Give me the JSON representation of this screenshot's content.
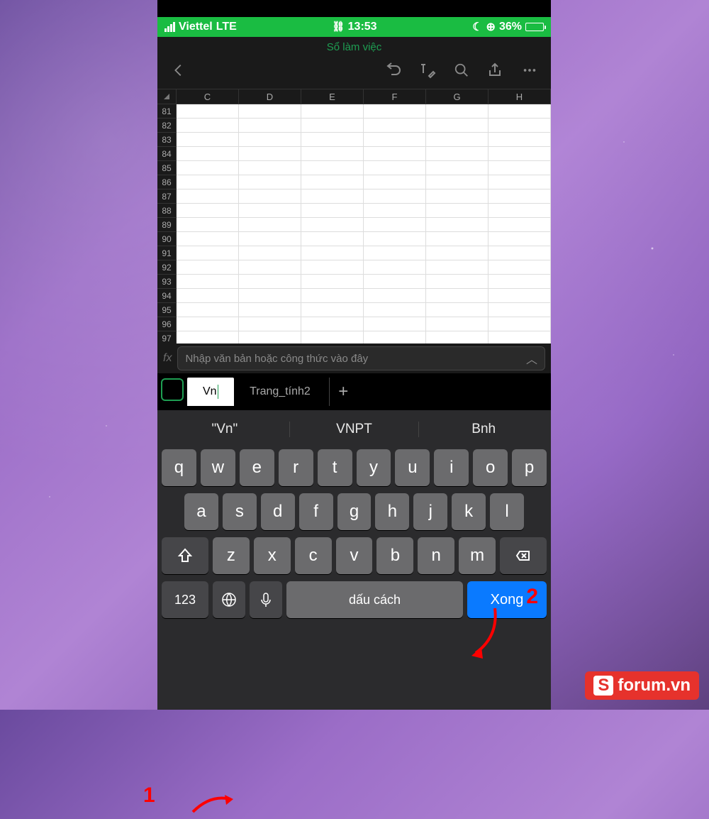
{
  "status": {
    "carrier": "Viettel",
    "network": "LTE",
    "time": "13:53",
    "battery": "36%"
  },
  "header": {
    "title": "Sổ làm việc"
  },
  "columns": [
    "C",
    "D",
    "E",
    "F",
    "G",
    "H"
  ],
  "rows": [
    "81",
    "82",
    "83",
    "84",
    "85",
    "86",
    "87",
    "88",
    "89",
    "90",
    "91",
    "92",
    "93",
    "94",
    "95",
    "96",
    "97"
  ],
  "formula": {
    "fx": "fx",
    "placeholder": "Nhập văn bản hoặc công thức vào đây"
  },
  "tabs": {
    "active_text": "Vn",
    "other": "Trang_tính2",
    "add": "+"
  },
  "suggestions": [
    "\"Vn\"",
    "VNPT",
    "Bnh"
  ],
  "keys": {
    "row1": [
      "q",
      "w",
      "e",
      "r",
      "t",
      "y",
      "u",
      "i",
      "o",
      "p"
    ],
    "row2": [
      "a",
      "s",
      "d",
      "f",
      "g",
      "h",
      "j",
      "k",
      "l"
    ],
    "row3": [
      "z",
      "x",
      "c",
      "v",
      "b",
      "n",
      "m"
    ],
    "num": "123",
    "space": "dấu cách",
    "action": "Xong"
  },
  "annotations": {
    "one": "1",
    "two": "2"
  },
  "watermark": {
    "s": "S",
    "text": "forum.vn"
  }
}
